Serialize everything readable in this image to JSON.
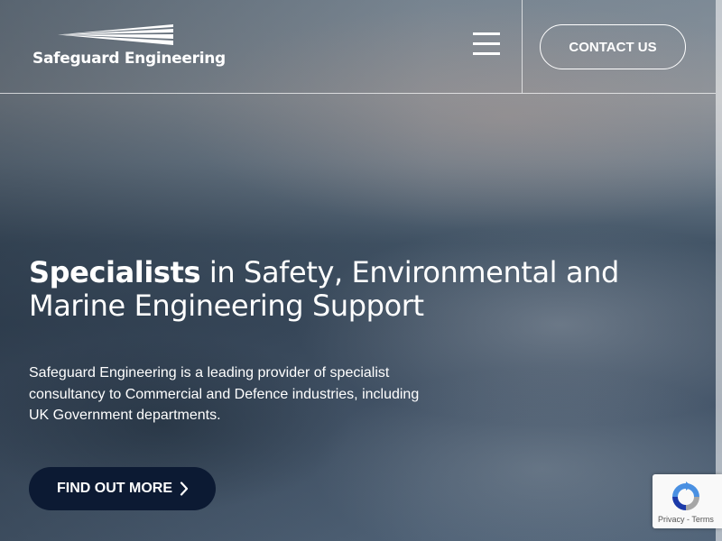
{
  "header": {
    "logo_text": "Safeguard Engineering",
    "menu_icon": "hamburger-menu-icon",
    "contact_label": "CONTACT US"
  },
  "hero": {
    "headline_strong": "Specialists",
    "headline_rest": " in Safety, Environmental and Marine Engineering Support",
    "description": "Safeguard Engineering is a leading provider of specialist consultancy to Commercial and Defence industries, including UK Government departments.",
    "cta_label": "FIND OUT MORE",
    "cta_icon": "chevron-right-icon"
  },
  "recaptcha": {
    "icon": "recaptcha-icon",
    "privacy_label": "Privacy",
    "separator": " - ",
    "terms_label": "Terms"
  },
  "colors": {
    "button_dark": "#0c1a33",
    "text": "#ffffff"
  }
}
